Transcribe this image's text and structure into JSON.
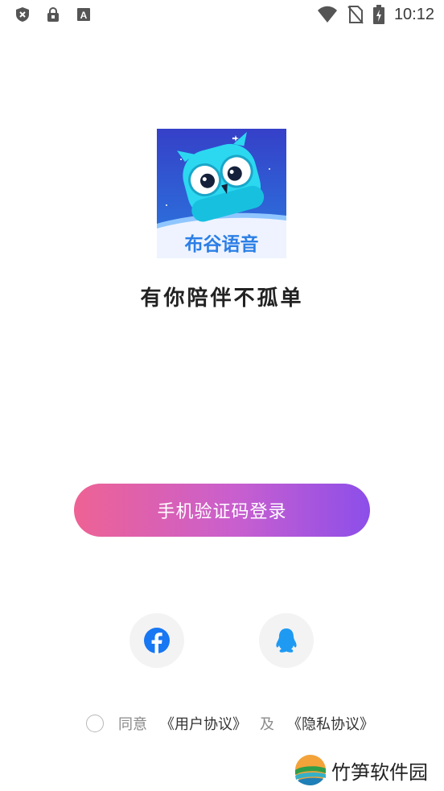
{
  "status_bar": {
    "time": "10:12",
    "icons": [
      "shield-x-icon",
      "lock-icon",
      "keyboard-a-icon",
      "wifi-icon",
      "no-sim-icon",
      "battery-charging-icon"
    ]
  },
  "logo": {
    "text": "布谷语音"
  },
  "tagline": "有你陪伴不孤单",
  "login": {
    "button_label": "手机验证码登录"
  },
  "social_login": [
    "facebook-icon",
    "qq-icon"
  ],
  "agreement": {
    "prefix": "同意",
    "user_agreement": "《用户协议》",
    "conjunction": "及",
    "privacy_agreement": "《隐私协议》"
  },
  "watermark": {
    "text": "竹笋软件园"
  },
  "colors": {
    "gradient_start": "#ee6294",
    "gradient_end": "#8c4ee9",
    "facebook": "#1877f2",
    "qq": "#1e9af3"
  }
}
